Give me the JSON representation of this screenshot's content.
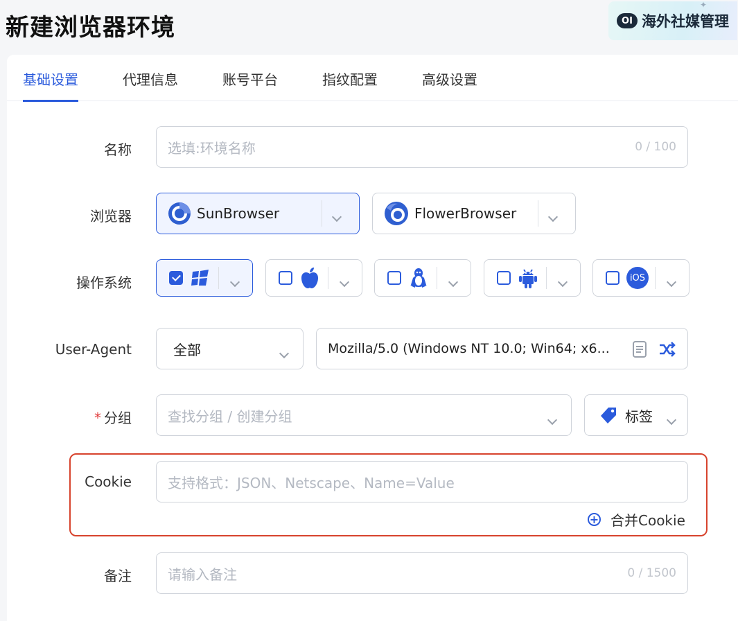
{
  "page": {
    "title": "新建浏览器环境"
  },
  "brand": {
    "logo_text": "OI",
    "name": "海外社媒管理"
  },
  "tabs": [
    {
      "label": "基础设置",
      "active": true
    },
    {
      "label": "代理信息",
      "active": false
    },
    {
      "label": "账号平台",
      "active": false
    },
    {
      "label": "指纹配置",
      "active": false
    },
    {
      "label": "高级设置",
      "active": false
    }
  ],
  "form": {
    "name": {
      "label": "名称",
      "placeholder": "选填:环境名称",
      "counter": "0 / 100"
    },
    "browser": {
      "label": "浏览器",
      "options": [
        {
          "name": "SunBrowser",
          "selected": true,
          "icon": "chrome-icon"
        },
        {
          "name": "FlowerBrowser",
          "selected": false,
          "icon": "firefox-icon"
        }
      ]
    },
    "os": {
      "label": "操作系统",
      "options": [
        {
          "name": "windows",
          "checked": true,
          "icon": "windows-icon"
        },
        {
          "name": "mac",
          "checked": false,
          "icon": "apple-icon"
        },
        {
          "name": "linux",
          "checked": false,
          "icon": "linux-icon"
        },
        {
          "name": "android",
          "checked": false,
          "icon": "android-icon"
        },
        {
          "name": "ios",
          "checked": false,
          "icon": "ios-icon",
          "icon_text": "iOS"
        }
      ]
    },
    "user_agent": {
      "label": "User-Agent",
      "filter": "全部",
      "value": "Mozilla/5.0 (Windows NT 10.0; Win64; x6..."
    },
    "group": {
      "label": "分组",
      "required_mark": "*",
      "placeholder": "查找分组 / 创建分组",
      "tag_label": "标签"
    },
    "cookie": {
      "label": "Cookie",
      "placeholder": "支持格式：JSON、Netscape、Name=Value",
      "merge_label": "合并Cookie"
    },
    "remark": {
      "label": "备注",
      "placeholder": "请输入备注",
      "counter": "0 / 1500"
    }
  },
  "colors": {
    "accent": "#2b5bdc",
    "highlight_border": "#d7432d"
  }
}
